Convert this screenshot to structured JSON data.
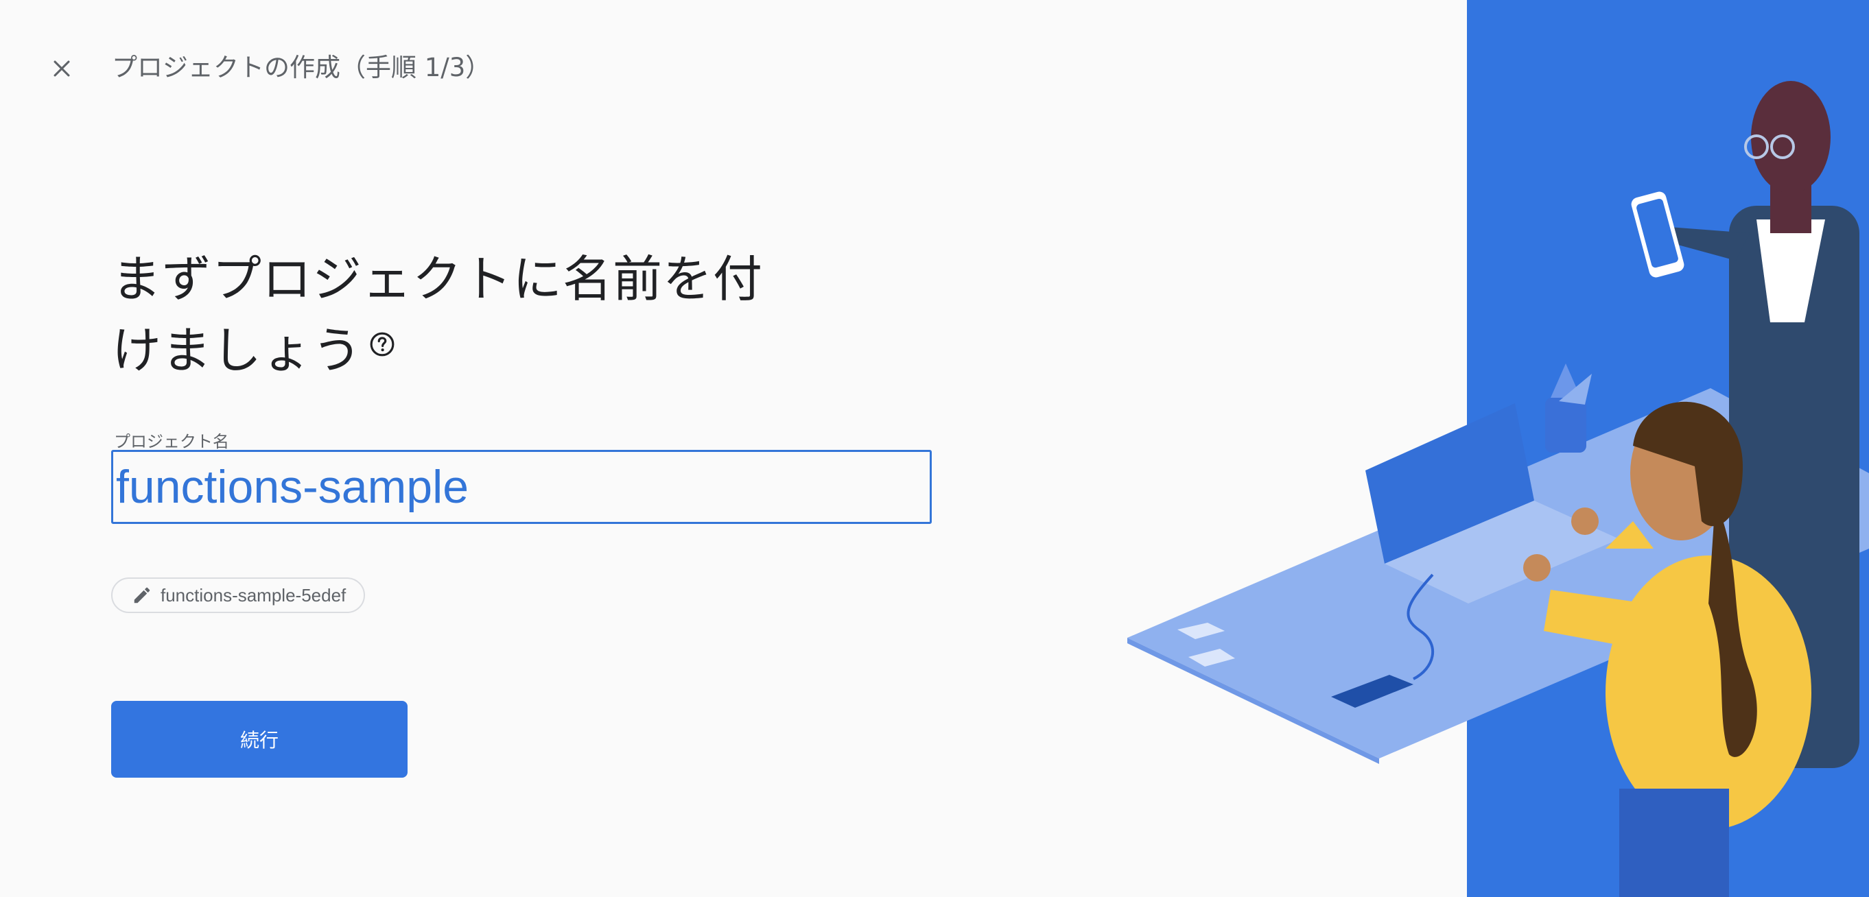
{
  "header": {
    "close_icon": "close-icon",
    "title": "プロジェクトの作成（手順 1/3）"
  },
  "main": {
    "heading_line1": "まずプロジェクトに名前を付",
    "heading_line2": "けましょう",
    "help_icon": "help-circle-icon",
    "project_name": {
      "label": "プロジェクト名",
      "value": "functions-sample"
    },
    "project_id_chip": {
      "icon": "pencil-icon",
      "text": "functions-sample-5edef"
    },
    "continue_label": "続行"
  },
  "colors": {
    "accent": "#3375d8",
    "panel_blue": "#3375e0",
    "background": "#fafafa"
  }
}
